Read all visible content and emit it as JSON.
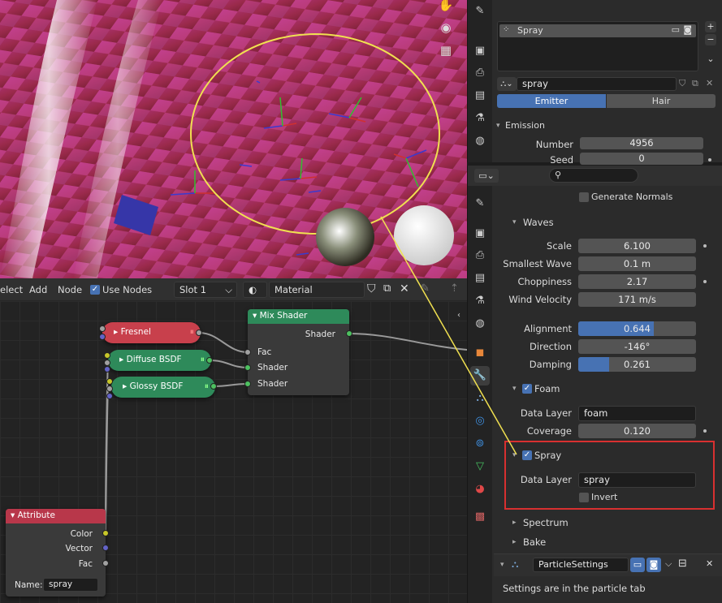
{
  "viewport": {
    "icons": [
      "hand-icon",
      "camera-icon",
      "grid-icon"
    ]
  },
  "node_header": {
    "select": "elect",
    "add": "Add",
    "node": "Node",
    "use_nodes": "Use Nodes",
    "slot": "Slot 1",
    "material": "Material"
  },
  "nodes": {
    "mix_shader": {
      "title": "Mix Shader",
      "out": "Shader",
      "fac": "Fac",
      "in1": "Shader",
      "in2": "Shader"
    },
    "fresnel": "Fresnel",
    "diffuse": "Diffuse BSDF",
    "glossy": "Glossy BSDF",
    "attribute": {
      "title": "Attribute",
      "color": "Color",
      "vector": "Vector",
      "fac": "Fac",
      "name_label": "Name:",
      "name_value": "spray"
    }
  },
  "particles_panel": {
    "list_item": "Spray",
    "settings_name": "spray",
    "emitter": "Emitter",
    "hair": "Hair",
    "emission": "Emission",
    "number_label": "Number",
    "number_value": "4956",
    "seed_label": "Seed",
    "seed_value": "0"
  },
  "ocean_panel": {
    "generate_normals": "Generate Normals",
    "waves": "Waves",
    "scale_label": "Scale",
    "scale_value": "6.100",
    "smallest_label": "Smallest Wave",
    "smallest_value": "0.1 m",
    "choppiness_label": "Choppiness",
    "choppiness_value": "2.17",
    "wind_label": "Wind Velocity",
    "wind_value": "171 m/s",
    "alignment_label": "Alignment",
    "alignment_value": "0.644",
    "alignment_fraction": 0.644,
    "direction_label": "Direction",
    "direction_value": "-146°",
    "damping_label": "Damping",
    "damping_value": "0.261",
    "damping_fraction": 0.261,
    "foam": "Foam",
    "foam_layer_label": "Data Layer",
    "foam_layer_value": "foam",
    "coverage_label": "Coverage",
    "coverage_value": "0.120",
    "spray": "Spray",
    "spray_layer_label": "Data Layer",
    "spray_layer_value": "spray",
    "invert": "Invert",
    "spectrum": "Spectrum",
    "bake": "Bake",
    "particle_settings": "ParticleSettings",
    "info": "Settings are in the particle tab"
  },
  "colors": {
    "accent": "#4772b3",
    "highlight": "#d83030",
    "annotation": "#f0e050"
  }
}
